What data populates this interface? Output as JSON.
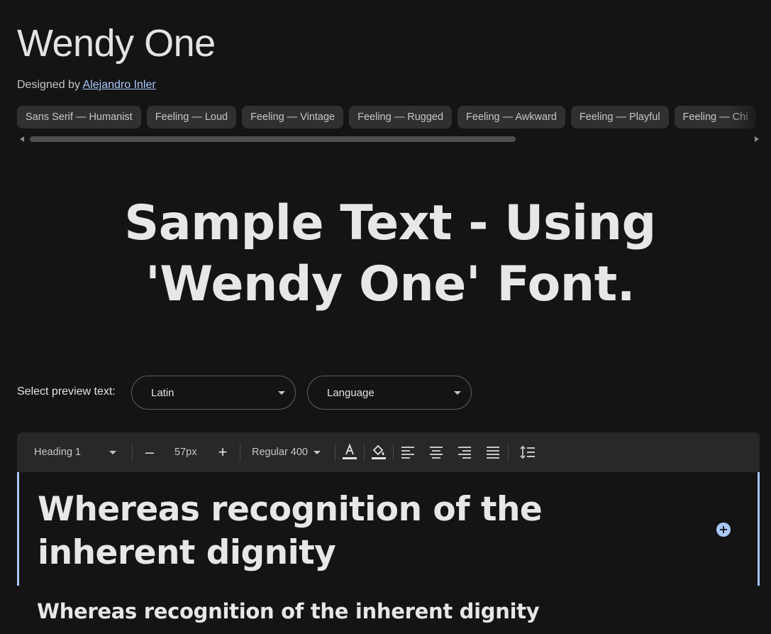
{
  "font": {
    "name": "Wendy One",
    "designed_by_label": "Designed by",
    "designer": "Alejandro Inler"
  },
  "tags": [
    "Sans Serif — Humanist",
    "Feeling — Loud",
    "Feeling — Vintage",
    "Feeling — Rugged",
    "Feeling — Awkward",
    "Feeling — Playful",
    "Feeling — Chi"
  ],
  "sample_text": "Sample Text - Using 'Wendy One' Font.",
  "preview": {
    "label": "Select preview text:",
    "script_value": "Latin",
    "language_value": "Language"
  },
  "toolbar": {
    "style_value": "Heading 1",
    "decrease_label": "–",
    "size_value": "57px",
    "increase_label": "+",
    "weight_value": "Regular 400",
    "icons": [
      "text-color-icon",
      "fill-color-icon",
      "align-left-icon",
      "align-center-icon",
      "align-right-icon",
      "align-justify-icon",
      "line-height-icon"
    ]
  },
  "editor": {
    "heading1_text": "Whereas recognition of the inherent dignity",
    "add_button_label": "+",
    "heading2_text": "Whereas recognition of the inherent dignity"
  },
  "colors": {
    "background": "#141414",
    "accent": "#a8c7fa",
    "chip_bg": "#303030",
    "toolbar_bg": "#282828"
  }
}
